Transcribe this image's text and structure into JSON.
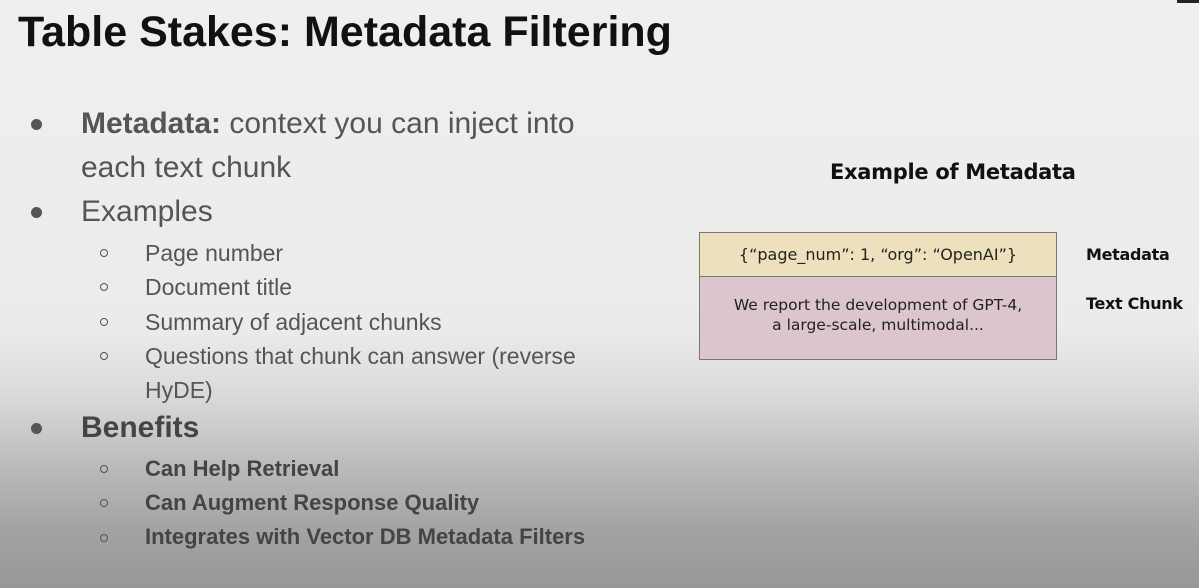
{
  "slide": {
    "title": "Table Stakes: Metadata Filtering"
  },
  "bullets": {
    "metadata": {
      "term": "Metadata:",
      "text_line1": " context you can inject into",
      "text_line2": "each text chunk"
    },
    "examples": {
      "label": "Examples",
      "items": [
        "Page number",
        "Document title",
        "Summary of adjacent chunks",
        "Questions that chunk can answer (reverse",
        "HyDE)"
      ]
    },
    "benefits": {
      "label": "Benefits",
      "items": [
        "Can Help Retrieval",
        "Can Augment Response Quality",
        "Integrates with Vector DB Metadata Filters"
      ]
    }
  },
  "example": {
    "title": "Example of Metadata",
    "metadata_box": "{“page_num”: 1, “org”: “OpenAI”}",
    "metadata_label": "Metadata",
    "chunk_line1": "We report the development of GPT-4,",
    "chunk_line2": "a large-scale, multimodal...",
    "chunk_label": "Text Chunk"
  },
  "colors": {
    "metadata_box_bg": "#ede1bd",
    "chunk_box_bg": "#dcc5cd",
    "title_text": "#111111",
    "bullet_text": "#555555"
  }
}
